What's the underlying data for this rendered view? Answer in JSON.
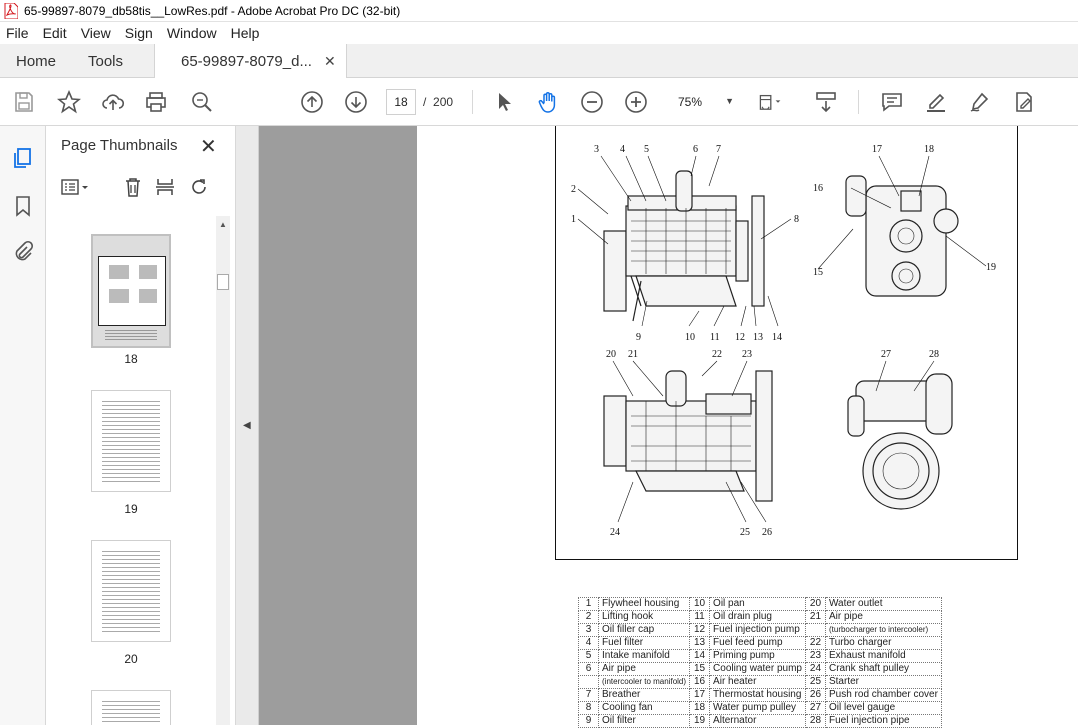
{
  "window": {
    "title": "65-99897-8079_db58tis__LowRes.pdf - Adobe Acrobat Pro DC (32-bit)"
  },
  "menu": [
    "File",
    "Edit",
    "View",
    "Sign",
    "Window",
    "Help"
  ],
  "tabs": {
    "home": "Home",
    "tools": "Tools",
    "document": "65-99897-8079_d..."
  },
  "toolbar": {
    "page_current": "18",
    "page_separator": "/",
    "page_total": "200",
    "zoom": "75%"
  },
  "panel": {
    "title": "Page Thumbnails",
    "thumbs": [
      {
        "label": "18"
      },
      {
        "label": "19"
      },
      {
        "label": "20"
      }
    ]
  },
  "figure": {
    "callouts": [
      "1",
      "2",
      "3",
      "4",
      "5",
      "6",
      "7",
      "8",
      "9",
      "10",
      "11",
      "12",
      "13",
      "14",
      "15",
      "16",
      "17",
      "18",
      "19",
      "20",
      "21",
      "22",
      "23",
      "24",
      "25",
      "26",
      "27",
      "28"
    ]
  },
  "legend": {
    "rows": [
      [
        "1",
        "Flywheel housing",
        "10",
        "Oil pan",
        "20",
        "Water outlet"
      ],
      [
        "2",
        "Lifting hook",
        "11",
        "Oil drain plug",
        "21",
        "Air pipe"
      ],
      [
        "3",
        "Oil filler cap",
        "12",
        "Fuel injection pump",
        "",
        "(turbocharger to intercooler)"
      ],
      [
        "4",
        "Fuel filter",
        "13",
        "Fuel feed pump",
        "22",
        "Turbo charger"
      ],
      [
        "5",
        "Intake manifold",
        "14",
        "Priming pump",
        "23",
        "Exhaust manifold"
      ],
      [
        "6",
        "Air pipe",
        "15",
        "Cooling water pump",
        "24",
        "Crank shaft pulley"
      ],
      [
        "",
        "(intercooler to manifold)",
        "16",
        "Air heater",
        "25",
        "Starter"
      ],
      [
        "7",
        "Breather",
        "17",
        "Thermostat housing",
        "26",
        "Push rod chamber cover"
      ],
      [
        "8",
        "Cooling fan",
        "18",
        "Water pump pulley",
        "27",
        "Oil level gauge"
      ],
      [
        "9",
        "Oil filter",
        "19",
        "Alternator",
        "28",
        "Fuel injection pipe"
      ]
    ]
  },
  "colors": {
    "accent": "#1473e6",
    "pdf_red": "#d4161c",
    "viewer_gray": "#9d9d9d"
  }
}
